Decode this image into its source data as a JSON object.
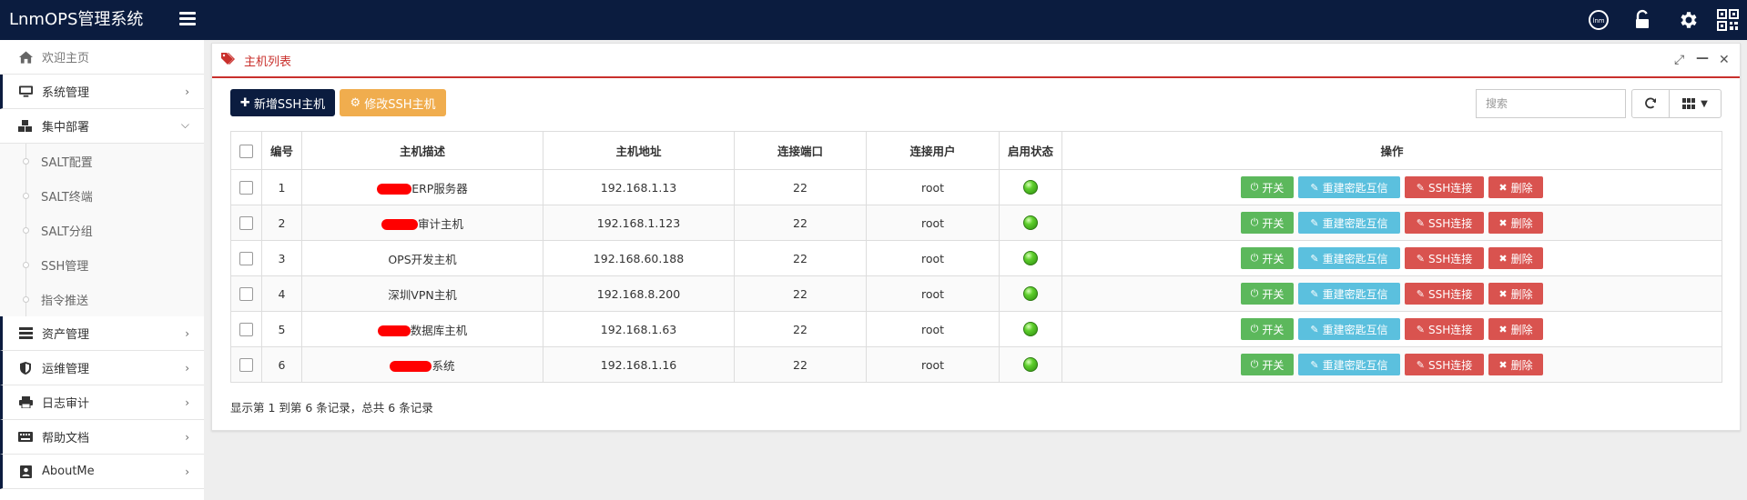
{
  "app": {
    "title": "LnmOPS管理系统"
  },
  "topbar": {
    "icons": [
      "lnm-logo-icon",
      "unlock-icon",
      "gear-icon",
      "qrcode-icon"
    ],
    "logo_text": "lnm"
  },
  "sidebar": {
    "home": "欢迎主页",
    "items": [
      {
        "label": "系统管理",
        "icon": "desktop-icon"
      },
      {
        "label": "集中部署",
        "icon": "cubes-icon",
        "expanded": true
      }
    ],
    "sub_items": [
      "SALT配置",
      "SALT终端",
      "SALT分组",
      "SSH管理",
      "指令推送"
    ],
    "items_after": [
      {
        "label": "资产管理",
        "icon": "list-icon"
      },
      {
        "label": "运维管理",
        "icon": "shield-icon"
      },
      {
        "label": "日志审计",
        "icon": "print-icon"
      },
      {
        "label": "帮助文档",
        "icon": "keyboard-icon"
      },
      {
        "label": "AboutMe",
        "icon": "contact-icon"
      }
    ]
  },
  "panel": {
    "title": "主机列表",
    "add_label": "新增SSH主机",
    "edit_label": "修改SSH主机",
    "search_placeholder": "搜索",
    "columns": [
      "编号",
      "主机描述",
      "主机地址",
      "连接端口",
      "连接用户",
      "启用状态",
      "操作"
    ],
    "actions": {
      "toggle": "开关",
      "rebuild": "重建密匙互信",
      "ssh": "SSH连接",
      "delete": "删除"
    },
    "rows": [
      {
        "id": "1",
        "desc_suffix": "ERP服务器",
        "addr": "192.168.1.13",
        "port": "22",
        "user": "root",
        "enabled": true
      },
      {
        "id": "2",
        "desc_suffix": "审计主机",
        "addr": "192.168.1.123",
        "port": "22",
        "user": "root",
        "enabled": true
      },
      {
        "id": "3",
        "desc_suffix": "OPS开发主机",
        "addr": "192.168.60.188",
        "port": "22",
        "user": "root",
        "enabled": true
      },
      {
        "id": "4",
        "desc_suffix": "深圳VPN主机",
        "addr": "192.168.8.200",
        "port": "22",
        "user": "root",
        "enabled": true
      },
      {
        "id": "5",
        "desc_suffix": "数据库主机",
        "addr": "192.168.1.63",
        "port": "22",
        "user": "root",
        "enabled": true
      },
      {
        "id": "6",
        "desc_suffix": "系统",
        "addr": "192.168.1.16",
        "port": "22",
        "user": "root",
        "enabled": true
      }
    ],
    "footer": "显示第 1 到第 6 条记录，总共 6 条记录"
  },
  "colors": {
    "navy": "#0b1c3f",
    "accent": "#c9302c",
    "success": "#5cb85c",
    "info": "#5bc0de",
    "danger": "#d9534f",
    "warning": "#f0ad4e"
  }
}
